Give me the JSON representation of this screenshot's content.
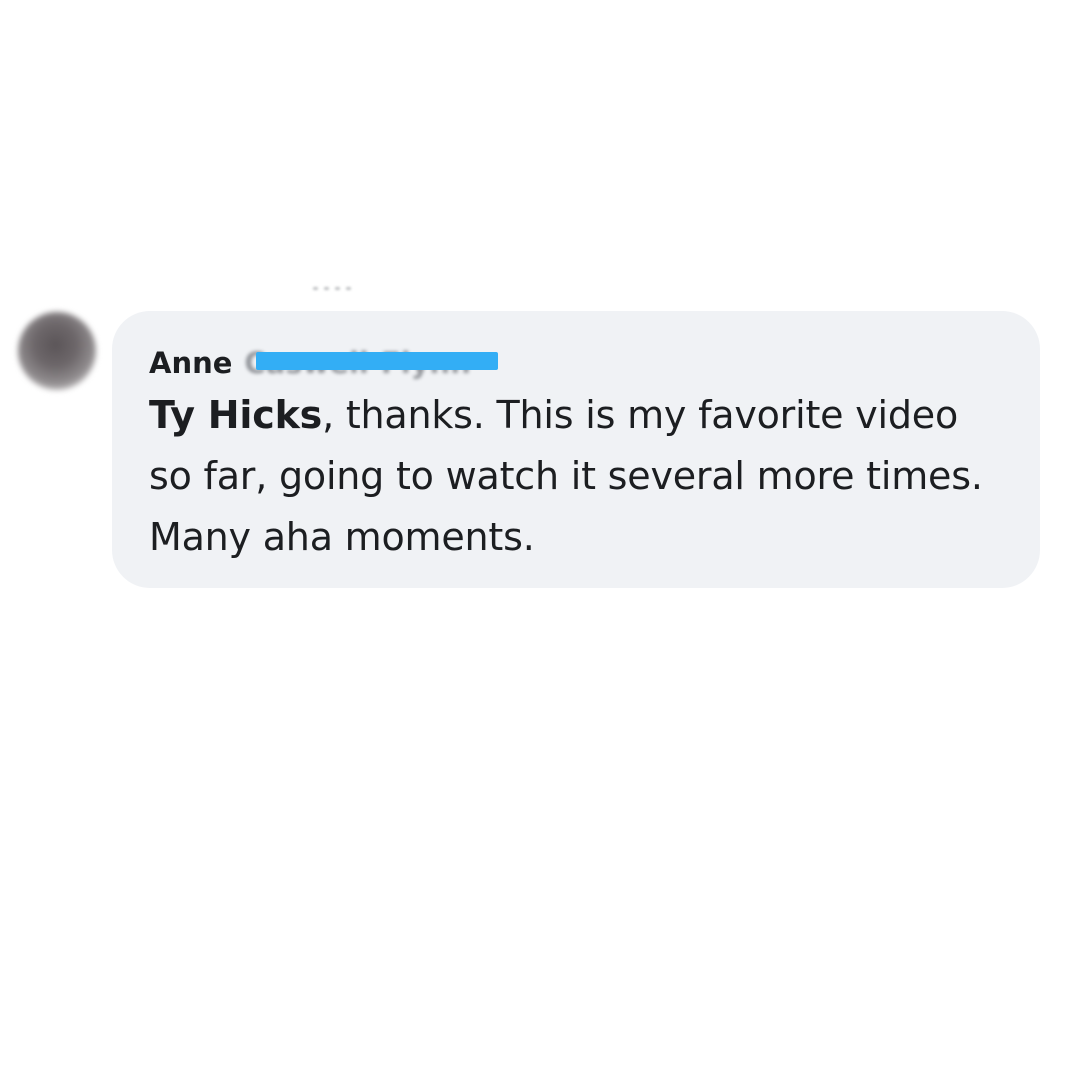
{
  "comment": {
    "author_first_name": "Anne",
    "author_last_name_redacted": "Caswell-Flynn",
    "mention": "Ty Hicks",
    "message": ", thanks. This is my favorite video so far, going to watch it several more times. Many aha moments.",
    "colors": {
      "bubble_background": "#f0f2f5",
      "redaction_bar": "#33aef5",
      "text": "#1c1e21"
    }
  },
  "icons": {
    "avatar": "user-avatar-blurred",
    "top_dots": "more-dots-icon"
  }
}
